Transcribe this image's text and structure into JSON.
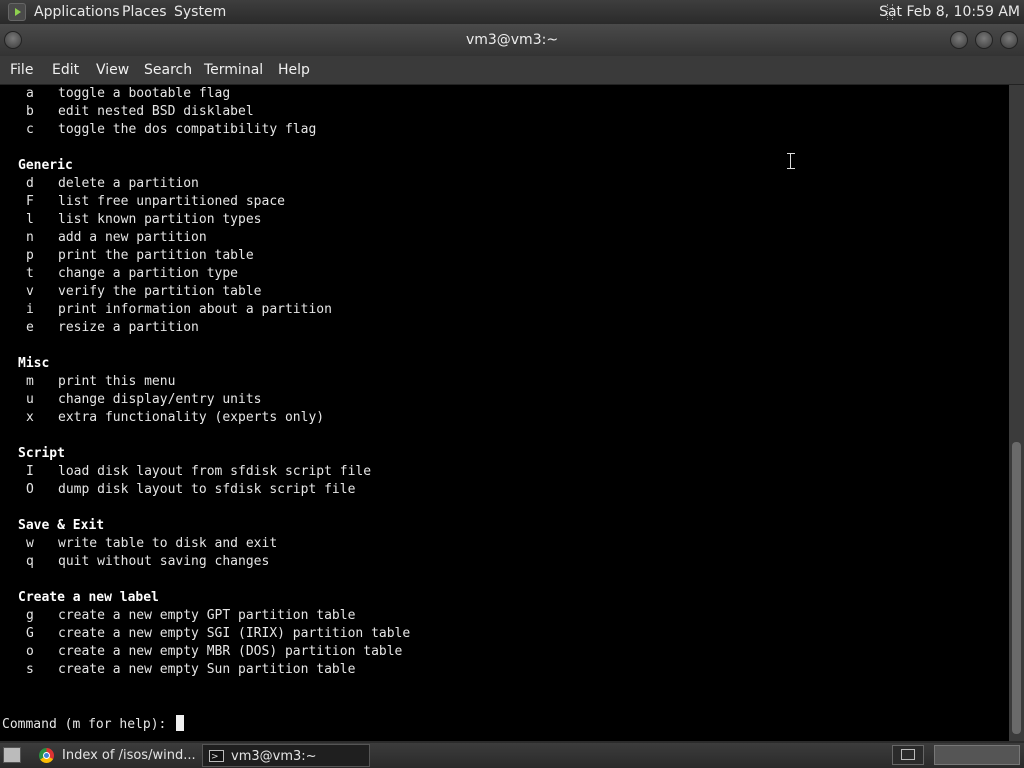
{
  "top_panel": {
    "menus": [
      "Applications",
      "Places",
      "System"
    ],
    "clock": "Sat Feb  8, 10:59 AM"
  },
  "window": {
    "title": "vm3@vm3:~"
  },
  "menubar": [
    "File",
    "Edit",
    "View",
    "Search",
    "Terminal",
    "Help"
  ],
  "terminal": {
    "lines": [
      {
        "kind": "cmd",
        "key": "a",
        "desc": "toggle a bootable flag"
      },
      {
        "kind": "cmd",
        "key": "b",
        "desc": "edit nested BSD disklabel"
      },
      {
        "kind": "cmd",
        "key": "c",
        "desc": "toggle the dos compatibility flag"
      },
      {
        "kind": "blank"
      },
      {
        "kind": "section",
        "text": "Generic"
      },
      {
        "kind": "cmd",
        "key": "d",
        "desc": "delete a partition"
      },
      {
        "kind": "cmd",
        "key": "F",
        "desc": "list free unpartitioned space"
      },
      {
        "kind": "cmd",
        "key": "l",
        "desc": "list known partition types"
      },
      {
        "kind": "cmd",
        "key": "n",
        "desc": "add a new partition"
      },
      {
        "kind": "cmd",
        "key": "p",
        "desc": "print the partition table"
      },
      {
        "kind": "cmd",
        "key": "t",
        "desc": "change a partition type"
      },
      {
        "kind": "cmd",
        "key": "v",
        "desc": "verify the partition table"
      },
      {
        "kind": "cmd",
        "key": "i",
        "desc": "print information about a partition"
      },
      {
        "kind": "cmd",
        "key": "e",
        "desc": "resize a partition"
      },
      {
        "kind": "blank"
      },
      {
        "kind": "section",
        "text": "Misc"
      },
      {
        "kind": "cmd",
        "key": "m",
        "desc": "print this menu"
      },
      {
        "kind": "cmd",
        "key": "u",
        "desc": "change display/entry units"
      },
      {
        "kind": "cmd",
        "key": "x",
        "desc": "extra functionality (experts only)"
      },
      {
        "kind": "blank"
      },
      {
        "kind": "section",
        "text": "Script"
      },
      {
        "kind": "cmd",
        "key": "I",
        "desc": "load disk layout from sfdisk script file"
      },
      {
        "kind": "cmd",
        "key": "O",
        "desc": "dump disk layout to sfdisk script file"
      },
      {
        "kind": "blank"
      },
      {
        "kind": "section",
        "text": "Save & Exit"
      },
      {
        "kind": "cmd",
        "key": "w",
        "desc": "write table to disk and exit"
      },
      {
        "kind": "cmd",
        "key": "q",
        "desc": "quit without saving changes"
      },
      {
        "kind": "blank"
      },
      {
        "kind": "section",
        "text": "Create a new label"
      },
      {
        "kind": "cmd",
        "key": "g",
        "desc": "create a new empty GPT partition table"
      },
      {
        "kind": "cmd",
        "key": "G",
        "desc": "create a new empty SGI (IRIX) partition table"
      },
      {
        "kind": "cmd",
        "key": "o",
        "desc": "create a new empty MBR (DOS) partition table"
      },
      {
        "kind": "cmd",
        "key": "s",
        "desc": "create a new empty Sun partition table"
      }
    ],
    "prompt": "Command (m for help): "
  },
  "taskbar": {
    "tasks": [
      {
        "label": "Index of /isos/wind...",
        "icon": "chrome-icon"
      },
      {
        "label": "vm3@vm3:~",
        "icon": "terminal-icon"
      }
    ]
  }
}
